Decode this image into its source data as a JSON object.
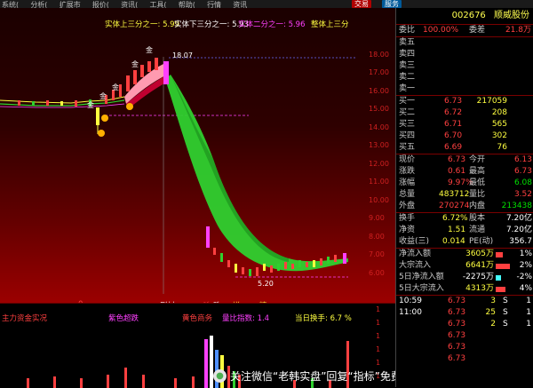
{
  "menu": {
    "items": [
      "系统(",
      "分析(",
      "扩展市",
      "报价(",
      "资讯(",
      "工具(",
      "帮助(",
      "行情",
      "资讯"
    ],
    "trade_button": "交易",
    "service_button": "服务"
  },
  "colors": {
    "accent": "#ff4040",
    "down": "#00e000",
    "band_down": "#2fd02f",
    "band_up": "#ff9ab0"
  },
  "chart": {
    "ma_labels": [
      {
        "text": "实体上三分之一: 5.99",
        "color": "#ffff40"
      },
      {
        "text": "实体下三分之一: 5.93",
        "color": "#ffffff"
      },
      {
        "text": "实体二分之一: 5.96",
        "color": "#ff40ff"
      },
      {
        "text": "整体上三分",
        "color": "#ffff40"
      }
    ],
    "price_axis": [
      "18.00",
      "17.00",
      "16.00",
      "15.00",
      "14.00",
      "13.00",
      "12.00",
      "11.00",
      "10.00",
      "9.00",
      "8.00",
      "7.00",
      "6.00"
    ],
    "high_label": "18.07",
    "low_label": "5.20",
    "marker_labels": [
      "金",
      "金",
      "金",
      "金",
      "金"
    ],
    "strip_labels": [
      {
        "text": "0",
        "color": "#ff4040"
      },
      {
        "text": "删材",
        "color": "#ffffff"
      },
      {
        "text": "杀",
        "color": "#ff4040"
      },
      {
        "text": "跌",
        "color": "#ffffff"
      },
      {
        "text": "增",
        "color": "#ffff40"
      },
      {
        "text": "精",
        "color": "#ffff40"
      }
    ],
    "sub_labels": [
      {
        "text": "主力资金实况",
        "color": "#ff4040"
      },
      {
        "text": "紫色超跌",
        "color": "#ff40ff"
      },
      {
        "text": "黄色商务",
        "color": "#ff4040"
      },
      {
        "text": "量比指数: 1.4",
        "color": "#ff40ff"
      },
      {
        "text": "当日换手: 6.7 %",
        "color": "#ffff40"
      }
    ],
    "sub_axis": [
      "1",
      "1",
      "1",
      "1",
      "1",
      "1"
    ]
  },
  "watermark": {
    "text": "关注微信“老韩实盘”回复“指标”免费领"
  },
  "quote": {
    "code": "002676",
    "name": "顺威股份",
    "weibi_label": "委比",
    "weibi_value": "100.00%",
    "weicha_label": "委差",
    "weicha_value": "21.8万",
    "sell": [
      {
        "label": "卖五",
        "price": "",
        "vol": ""
      },
      {
        "label": "卖四",
        "price": "",
        "vol": ""
      },
      {
        "label": "卖三",
        "price": "",
        "vol": ""
      },
      {
        "label": "卖二",
        "price": "",
        "vol": ""
      },
      {
        "label": "卖一",
        "price": "",
        "vol": ""
      }
    ],
    "buy": [
      {
        "label": "买一",
        "price": "6.73",
        "vol": "217059"
      },
      {
        "label": "买二",
        "price": "6.72",
        "vol": "208"
      },
      {
        "label": "买三",
        "price": "6.71",
        "vol": "565"
      },
      {
        "label": "买四",
        "price": "6.70",
        "vol": "302"
      },
      {
        "label": "买五",
        "price": "6.69",
        "vol": "76"
      }
    ],
    "stats": [
      {
        "l1": "现价",
        "v1": "6.73",
        "l2": "今开",
        "v2": "6.13"
      },
      {
        "l1": "涨跌",
        "v1": "0.61",
        "l2": "最高",
        "v2": "6.73"
      },
      {
        "l1": "涨幅",
        "v1": "9.97%",
        "l2": "最低",
        "v2": "6.08"
      },
      {
        "l1": "总量",
        "v1": "483712",
        "l2": "量比",
        "v2": "3.52"
      },
      {
        "l1": "外盘",
        "v1": "270274",
        "l2": "内盘",
        "v2": "213438"
      }
    ],
    "stats2": [
      {
        "l1": "换手",
        "v1": "6.72%",
        "l2": "股本",
        "v2": "7.20亿"
      },
      {
        "l1": "净资",
        "v1": "1.51",
        "l2": "流通",
        "v2": "7.20亿"
      },
      {
        "l1": "收益(三)",
        "v1": "0.014",
        "l2": "PE(动)",
        "v2": "356.7"
      }
    ],
    "flows": [
      {
        "label": "净流入额",
        "value": "3605万",
        "pct": "1%",
        "bar": 0.35,
        "color": "#ff4040"
      },
      {
        "label": "大宗流入",
        "value": "6641万",
        "pct": "2%",
        "bar": 0.65,
        "color": "#ff4040"
      },
      {
        "label": "5日净流入额",
        "value": "-2275万",
        "pct": "-2%",
        "bar": 0.25,
        "color": "#4ff"
      },
      {
        "label": "5日大宗流入",
        "value": "4313万",
        "pct": "4%",
        "bar": 0.45,
        "color": "#ff4040"
      }
    ],
    "ticks": [
      {
        "time": "10:59",
        "price": "6.73",
        "vol": "3",
        "dir": "S",
        "num": "1"
      },
      {
        "time": "11:00",
        "price": "6.73",
        "vol": "25",
        "dir": "S",
        "num": "1"
      },
      {
        "time": "",
        "price": "6.73",
        "vol": "2",
        "dir": "S",
        "num": "1"
      },
      {
        "time": "",
        "price": "6.73",
        "vol": "",
        "dir": "",
        "num": ""
      },
      {
        "time": "",
        "price": "6.73",
        "vol": "",
        "dir": "",
        "num": ""
      },
      {
        "time": "",
        "price": "6.73",
        "vol": "",
        "dir": "",
        "num": ""
      }
    ]
  }
}
